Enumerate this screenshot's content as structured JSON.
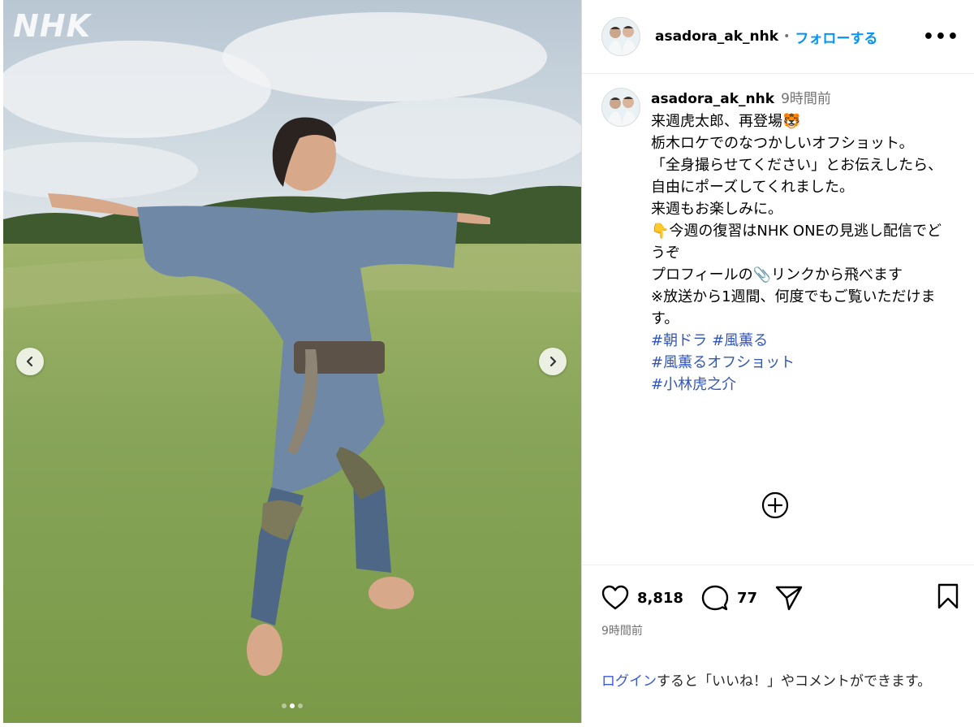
{
  "media": {
    "watermark": "NHK",
    "carousel_dots": 3,
    "active_dot": 1
  },
  "header": {
    "username": "asadora_ak_nhk",
    "separator": "•",
    "follow_label": "フォローする",
    "more_label": "•••"
  },
  "caption": {
    "username": "asadora_ak_nhk",
    "time": "9時間前",
    "lines": [
      "来週虎太郎、再登場🐯",
      "栃木ロケでのなつかしいオフショット。",
      "「全身撮らせてください」とお伝えしたら、自由にポーズしてくれました。",
      "来週もお楽しみに。",
      "",
      "👇今週の復習はNHK ONEの見逃し配信でどうぞ",
      "プロフィールの📎リンクから飛べます",
      "※放送から1週間、何度でもご覧いただけます。",
      ""
    ],
    "hashtags_line1": [
      "#朝ドラ",
      "#風薫る"
    ],
    "hashtags_line2": "#風薫るオフショット",
    "hashtags_line3": "#小林虎之介"
  },
  "actions": {
    "likes": "8,818",
    "comments": "77",
    "posted": "9時間前"
  },
  "login_prompt": {
    "login_link": "ログイン",
    "rest": "すると「いいね！」やコメントができます。"
  },
  "colors": {
    "follow": "#0095f6",
    "hashtag": "#3456b8",
    "muted": "#737373"
  }
}
